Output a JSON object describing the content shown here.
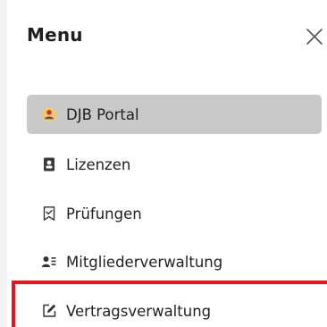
{
  "menu": {
    "title": "Menu",
    "close_icon": "close-icon"
  },
  "nav": {
    "items": [
      {
        "label": "DJB Portal",
        "icon": "portal-icon",
        "active": true
      },
      {
        "label": "Lizenzen",
        "icon": "license-id-icon",
        "active": false
      },
      {
        "label": "Prüfungen",
        "icon": "bookmark-check-icon",
        "active": false
      },
      {
        "label": "Mitgliederverwaltung",
        "icon": "members-icon",
        "active": false
      },
      {
        "label": "Vertragsverwaltung",
        "icon": "edit-icon",
        "active": false
      }
    ]
  },
  "colors": {
    "active_background": "#c9c9c9",
    "highlight_border": "#e8141b"
  }
}
